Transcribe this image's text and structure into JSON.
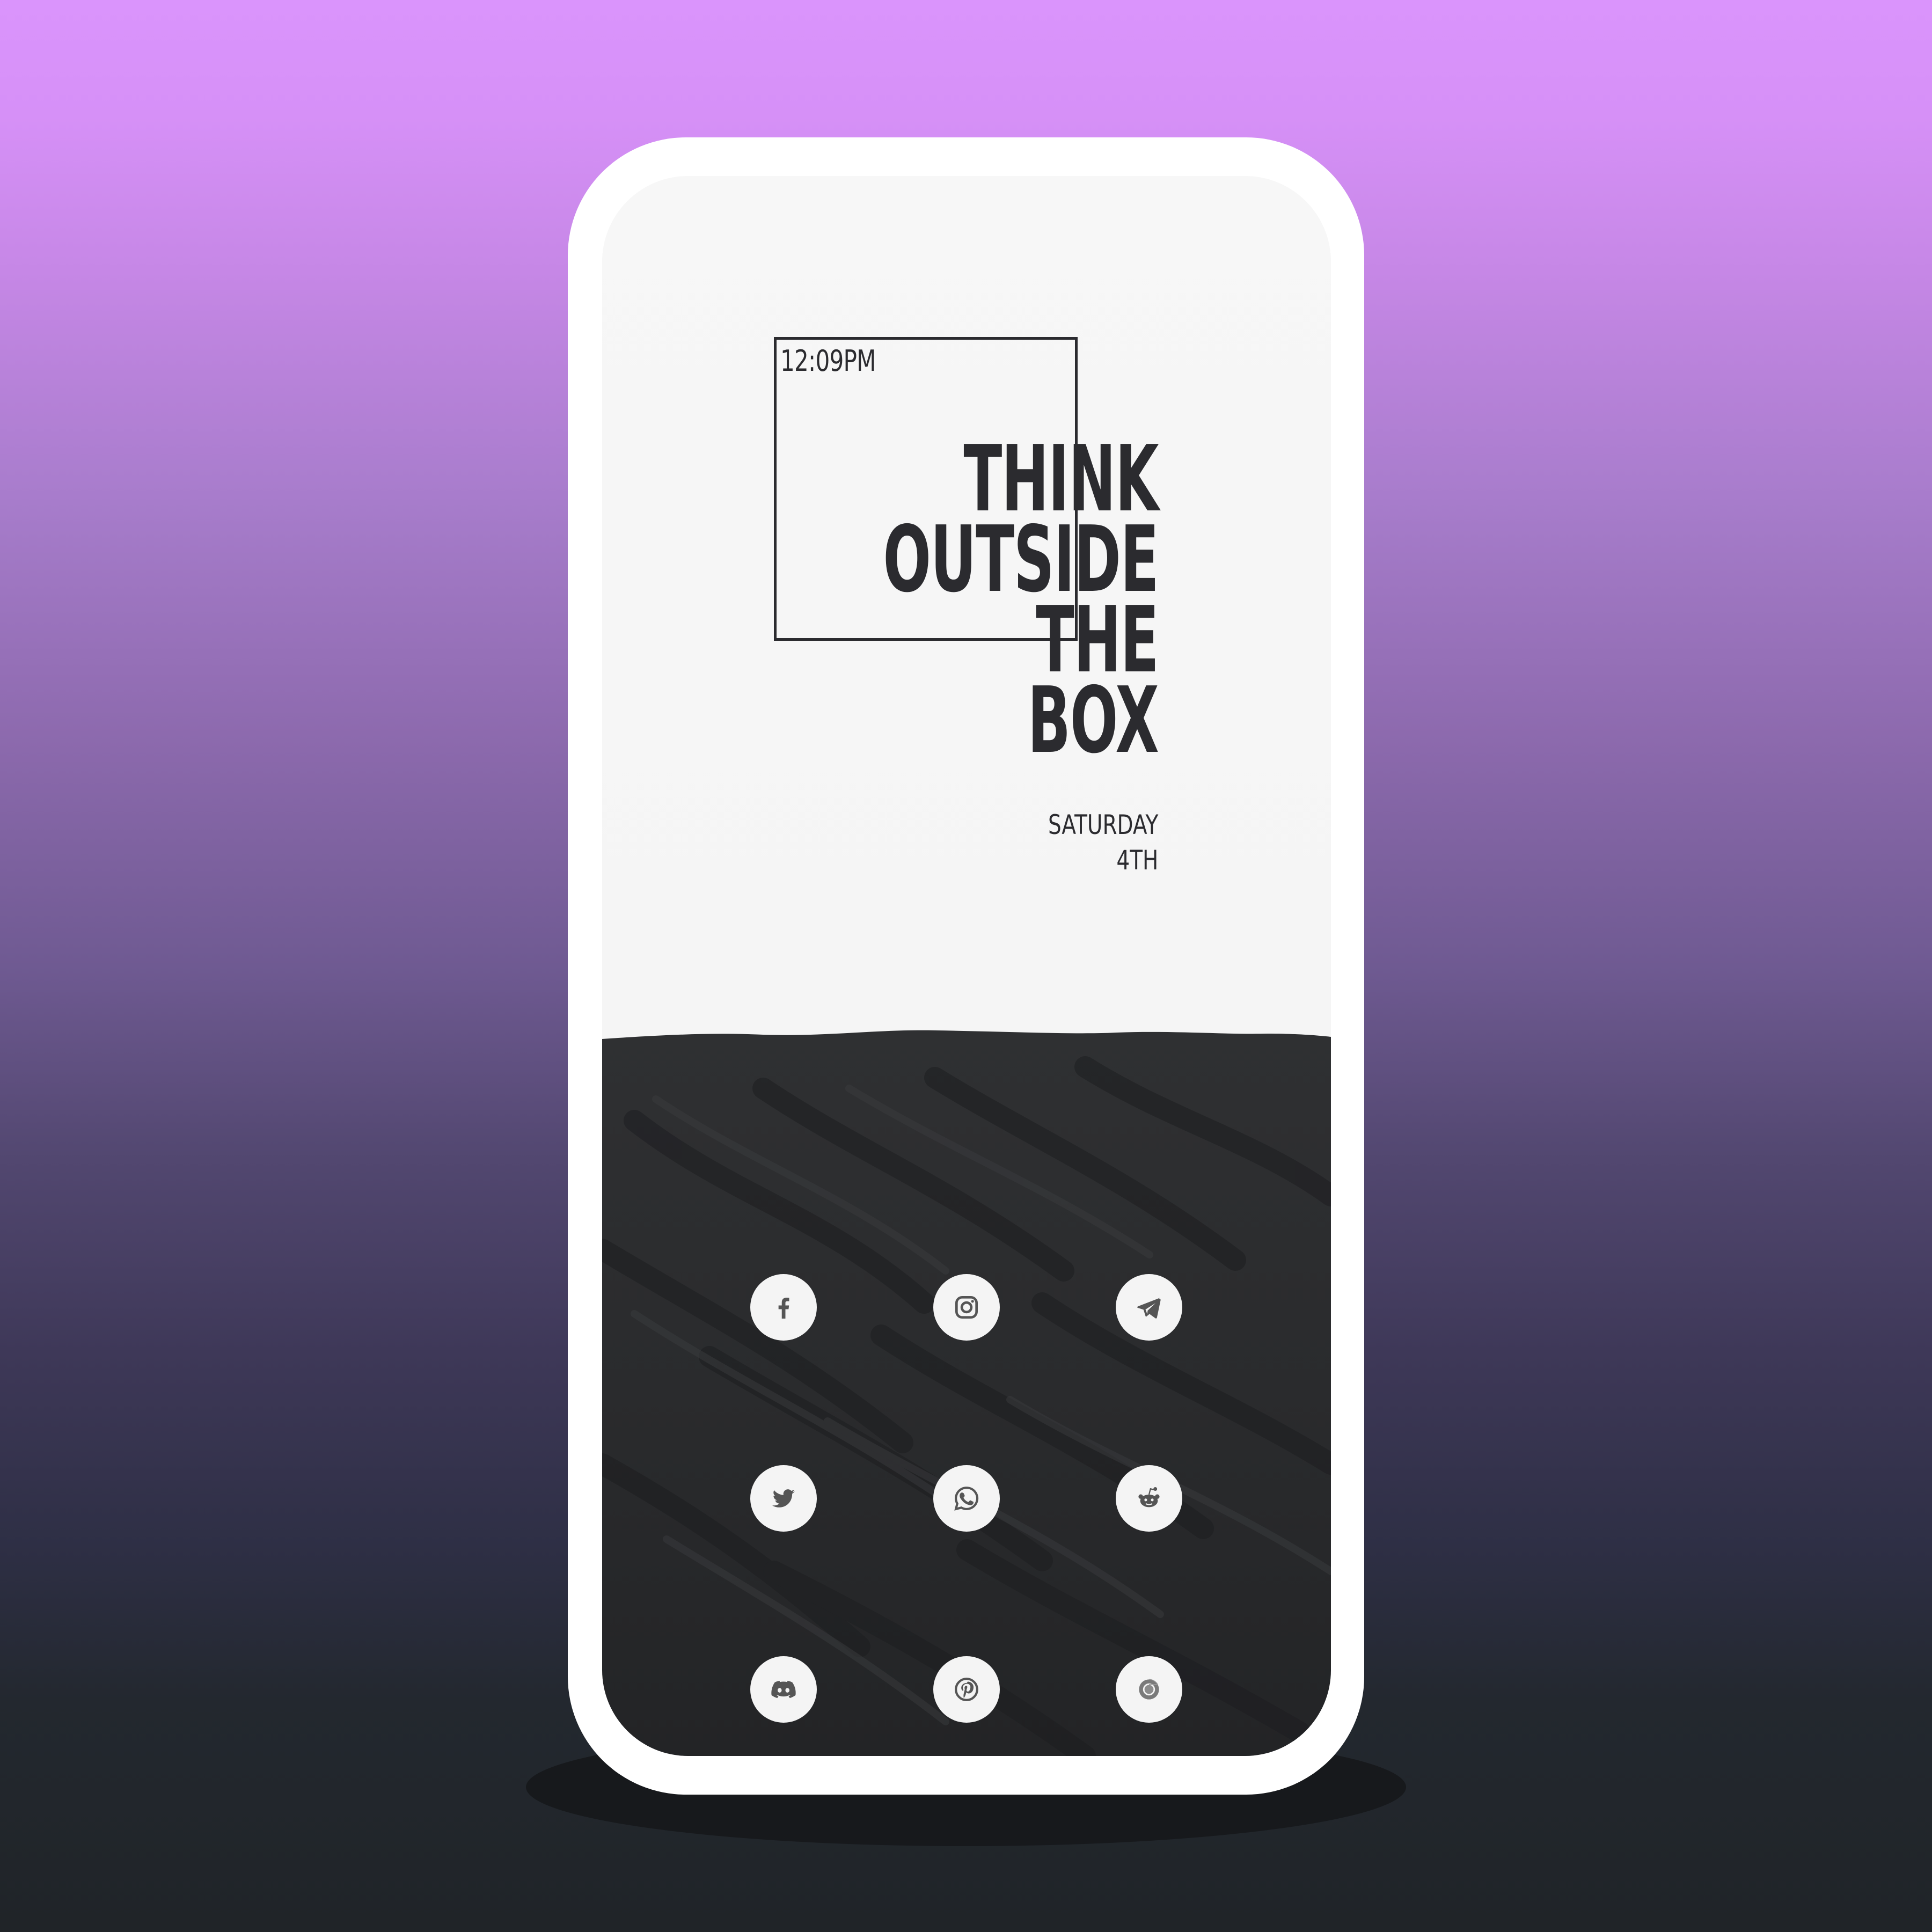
{
  "background": {
    "gradient_top": "#da94fc",
    "gradient_bottom": "#202428"
  },
  "lockscreen": {
    "time": "12:09PM",
    "quote_lines": [
      "THINK",
      "OUTSIDE",
      "THE",
      "BOX"
    ],
    "date_day": "SATURDAY",
    "date_number": "4TH",
    "text_color": "#2b2b2f"
  },
  "apps": [
    {
      "icon": "facebook-icon"
    },
    {
      "icon": "instagram-icon"
    },
    {
      "icon": "telegram-icon"
    },
    {
      "icon": "twitter-icon"
    },
    {
      "icon": "whatsapp-icon"
    },
    {
      "icon": "reddit-icon"
    },
    {
      "icon": "discord-icon"
    },
    {
      "icon": "pinterest-icon"
    },
    {
      "icon": "chrome-icon"
    }
  ]
}
